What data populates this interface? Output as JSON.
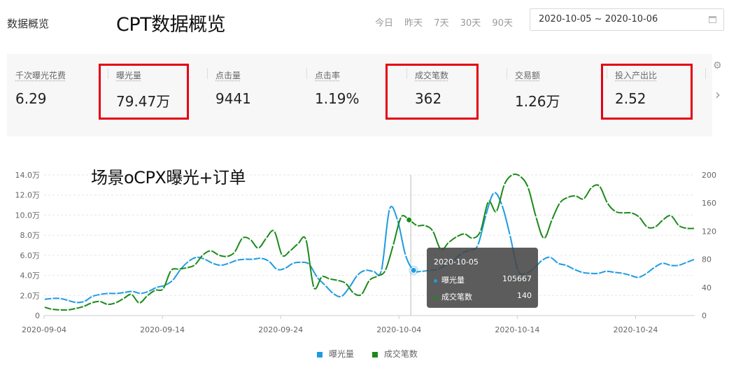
{
  "header": {
    "page_label": "数据概览",
    "big_title": "CPT数据概览",
    "range_tabs": [
      "今日",
      "昨天",
      "7天",
      "30天",
      "90天"
    ],
    "date_range": "2020-10-05 ~ 2020-10-06"
  },
  "metrics": [
    {
      "label": "千次曝光花费",
      "value": "6.29"
    },
    {
      "label": "曝光量",
      "value": "79.47万"
    },
    {
      "label": "点击量",
      "value": "9441"
    },
    {
      "label": "点击率",
      "value": "1.19%"
    },
    {
      "label": "成交笔数",
      "value": "362"
    },
    {
      "label": "交易额",
      "value": "1.26万"
    },
    {
      "label": "投入产出比",
      "value": "2.52"
    }
  ],
  "annotation": "场景oCPX曝光+订单",
  "colors": {
    "blue": "#1e9be0",
    "green": "#1a8a1a",
    "highlight": "#e60012"
  },
  "tooltip": {
    "date": "2020-10-05",
    "rows": [
      {
        "name": "曝光量",
        "value": "105667"
      },
      {
        "name": "成交笔数",
        "value": "140"
      }
    ]
  },
  "chart_data": {
    "type": "line",
    "start_date": "2020-09-04",
    "end_date": "2020-10-29",
    "x_ticks": [
      "2020-09-04",
      "2020-09-14",
      "2020-09-24",
      "2020-10-04",
      "2020-10-14",
      "2020-10-24"
    ],
    "y_left": {
      "ticks": [
        "0",
        "2.0万",
        "4.0万",
        "6.0万",
        "8.0万",
        "10.0万",
        "12.0万",
        "14.0万"
      ],
      "range": [
        0,
        140000
      ]
    },
    "y_right": {
      "ticks": [
        "0",
        "40",
        "80",
        "120",
        "160",
        "200"
      ],
      "range": [
        0,
        200
      ]
    },
    "grid": true,
    "legend": "bottom",
    "series": [
      {
        "name": "曝光量",
        "axis": "left",
        "color": "#1e9be0",
        "values": [
          16000,
          17000,
          17000,
          15000,
          13000,
          14000,
          19000,
          21000,
          22000,
          22000,
          23000,
          24000,
          22000,
          24000,
          28000,
          30000,
          35000,
          46000,
          54000,
          58000,
          56000,
          52000,
          50000,
          52000,
          55000,
          56000,
          56000,
          57000,
          54000,
          46000,
          47000,
          52000,
          53000,
          51000,
          38000,
          30000,
          22000,
          19000,
          28000,
          40000,
          45000,
          44000,
          45000,
          105667,
          95000,
          60000,
          45000,
          44000,
          45000,
          46000,
          50000,
          55000,
          62000,
          65000,
          70000,
          100000,
          122000,
          110000,
          80000,
          45000,
          42000,
          47000,
          55000,
          58000,
          52000,
          50000,
          46000,
          43000,
          42000,
          42000,
          44000,
          43000,
          42000,
          40000,
          38000,
          42000,
          48000,
          52000,
          50000,
          50000,
          53000,
          56000
        ]
      },
      {
        "name": "成交笔数",
        "axis": "right",
        "color": "#1a8a1a",
        "values": [
          12,
          9,
          8,
          8,
          10,
          13,
          18,
          20,
          16,
          18,
          24,
          30,
          18,
          28,
          36,
          38,
          64,
          66,
          68,
          72,
          86,
          92,
          86,
          84,
          90,
          110,
          108,
          96,
          110,
          120,
          86,
          92,
          102,
          108,
          40,
          55,
          52,
          50,
          46,
          32,
          30,
          50,
          56,
          64,
          100,
          140,
          136,
          128,
          128,
          120,
          94,
          104,
          112,
          116,
          110,
          120,
          162,
          148,
          186,
          200,
          198,
          182,
          140,
          110,
          136,
          160,
          168,
          170,
          166,
          182,
          184,
          160,
          148,
          146,
          146,
          140,
          126,
          126,
          136,
          142,
          128,
          124,
          124
        ]
      }
    ]
  },
  "legend": [
    "曝光量",
    "成交笔数"
  ]
}
